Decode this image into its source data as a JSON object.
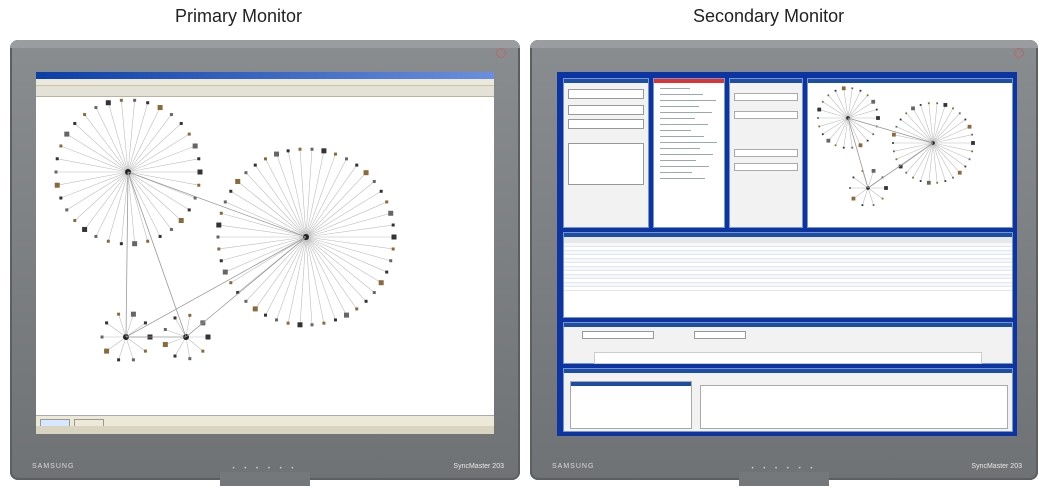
{
  "captions": {
    "primary": "Primary Monitor",
    "secondary": "Secondary Monitor"
  },
  "colors": {
    "bezel": "#7b7e81",
    "desktop_blue": "#0d34a3",
    "node_line": "#b8b8b8",
    "title_blue": "#0a3fa8"
  },
  "monitors": {
    "primary": {
      "brand": "SAMSUNG",
      "model": "SyncMaster 203"
    },
    "secondary": {
      "brand": "SAMSUNG",
      "model": "SyncMaster 203"
    }
  }
}
